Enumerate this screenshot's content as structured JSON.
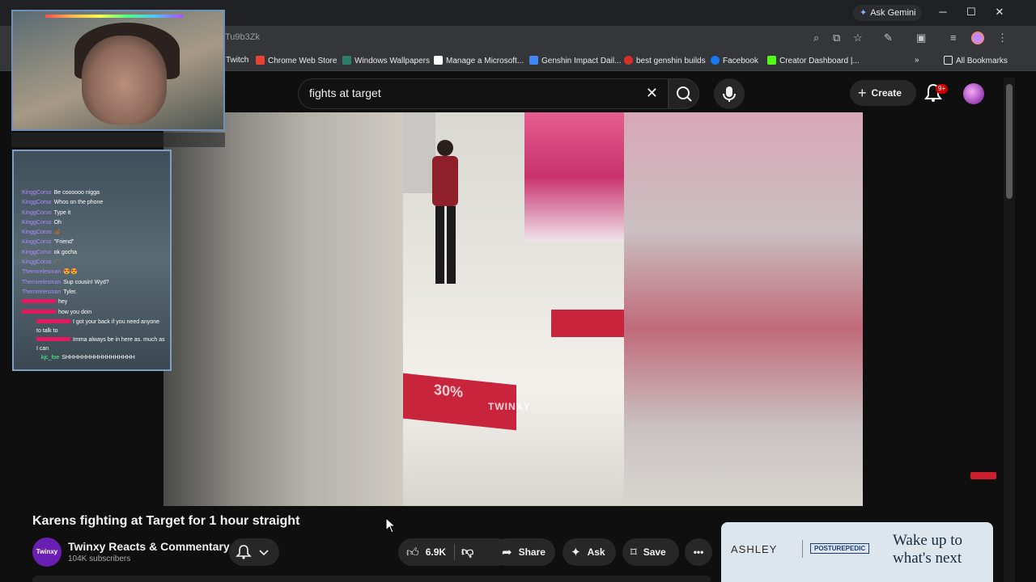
{
  "browser": {
    "ask_gemini": "Ask Gemini",
    "url_fragment": "Tu9b3Zk",
    "bookmarks": [
      {
        "label": "Twitch",
        "color": "#9146ff"
      },
      {
        "label": "Chrome Web Store",
        "color": "#e94235"
      },
      {
        "label": "Windows Wallpapers",
        "color": "#2e7d6b"
      },
      {
        "label": "Manage a Microsoft...",
        "color": "#ffffff"
      },
      {
        "label": "Genshin Impact Dail...",
        "color": "#4285f4"
      },
      {
        "label": "best genshin builds",
        "color": "#d93025"
      },
      {
        "label": "Facebook",
        "color": "#1877f2"
      },
      {
        "label": "Creator Dashboard |...",
        "color": "#53fc18"
      }
    ],
    "all_bookmarks": "All Bookmarks"
  },
  "youtube": {
    "search_query": "fights at target",
    "create_label": "Create",
    "notification_badge": "9+",
    "video": {
      "title": "Karens fighting at Target for 1 hour straight",
      "watermark": "TWINXY",
      "floor_sign": "30%"
    },
    "channel": {
      "avatar_text": "Twinxy",
      "name": "Twinxy Reacts & Commentary",
      "subscribers": "104K subscribers"
    },
    "actions": {
      "likes": "6.9K",
      "share": "Share",
      "ask": "Ask",
      "save": "Save"
    },
    "ad": {
      "brand": "ASHLEY",
      "partner": "POSTUREPEDIC",
      "tagline": "Wake up to what's next"
    }
  },
  "stream_chat": [
    {
      "user": "KinggCorso",
      "color": "#b388ff",
      "text": "Be coooooo nigga"
    },
    {
      "user": "KinggCorso",
      "color": "#b388ff",
      "text": "Whos on the phone"
    },
    {
      "user": "KinggCorso",
      "color": "#b388ff",
      "text": "Type it"
    },
    {
      "user": "KinggCorso",
      "color": "#b388ff",
      "text": "Oh"
    },
    {
      "user": "KinggCorso",
      "color": "#b388ff",
      "text": "👋🏾"
    },
    {
      "user": "KinggCorso",
      "color": "#b388ff",
      "text": "\"Friend\""
    },
    {
      "user": "KinggCorso",
      "color": "#b388ff",
      "text": "ok gocha"
    },
    {
      "user": "KinggCorso",
      "color": "#b388ff",
      "text": "🫥"
    },
    {
      "user": "Themirelesman",
      "color": "#a78bfa",
      "text": "😍😍"
    },
    {
      "user": "Themirelesman",
      "color": "#a78bfa",
      "text": "Sup cousin! Wyd?"
    },
    {
      "user": "Themirelesman",
      "color": "#a78bfa",
      "text": "Tyler."
    }
  ],
  "stream_chat_hidden_users": [
    {
      "color": "#e5195f",
      "text": "hey"
    },
    {
      "color": "#e5195f",
      "text": "how you doin"
    },
    {
      "color": "#e5195f",
      "text": "I got your back if you need anyone to talk to"
    },
    {
      "color": "#e5195f",
      "text": "Imma always be in here as. much as I can"
    }
  ],
  "stream_chat_last": {
    "user": "kjc_foe",
    "color": "#4dff88",
    "text": "SHHHHHHHHHHHHHHHHH"
  }
}
